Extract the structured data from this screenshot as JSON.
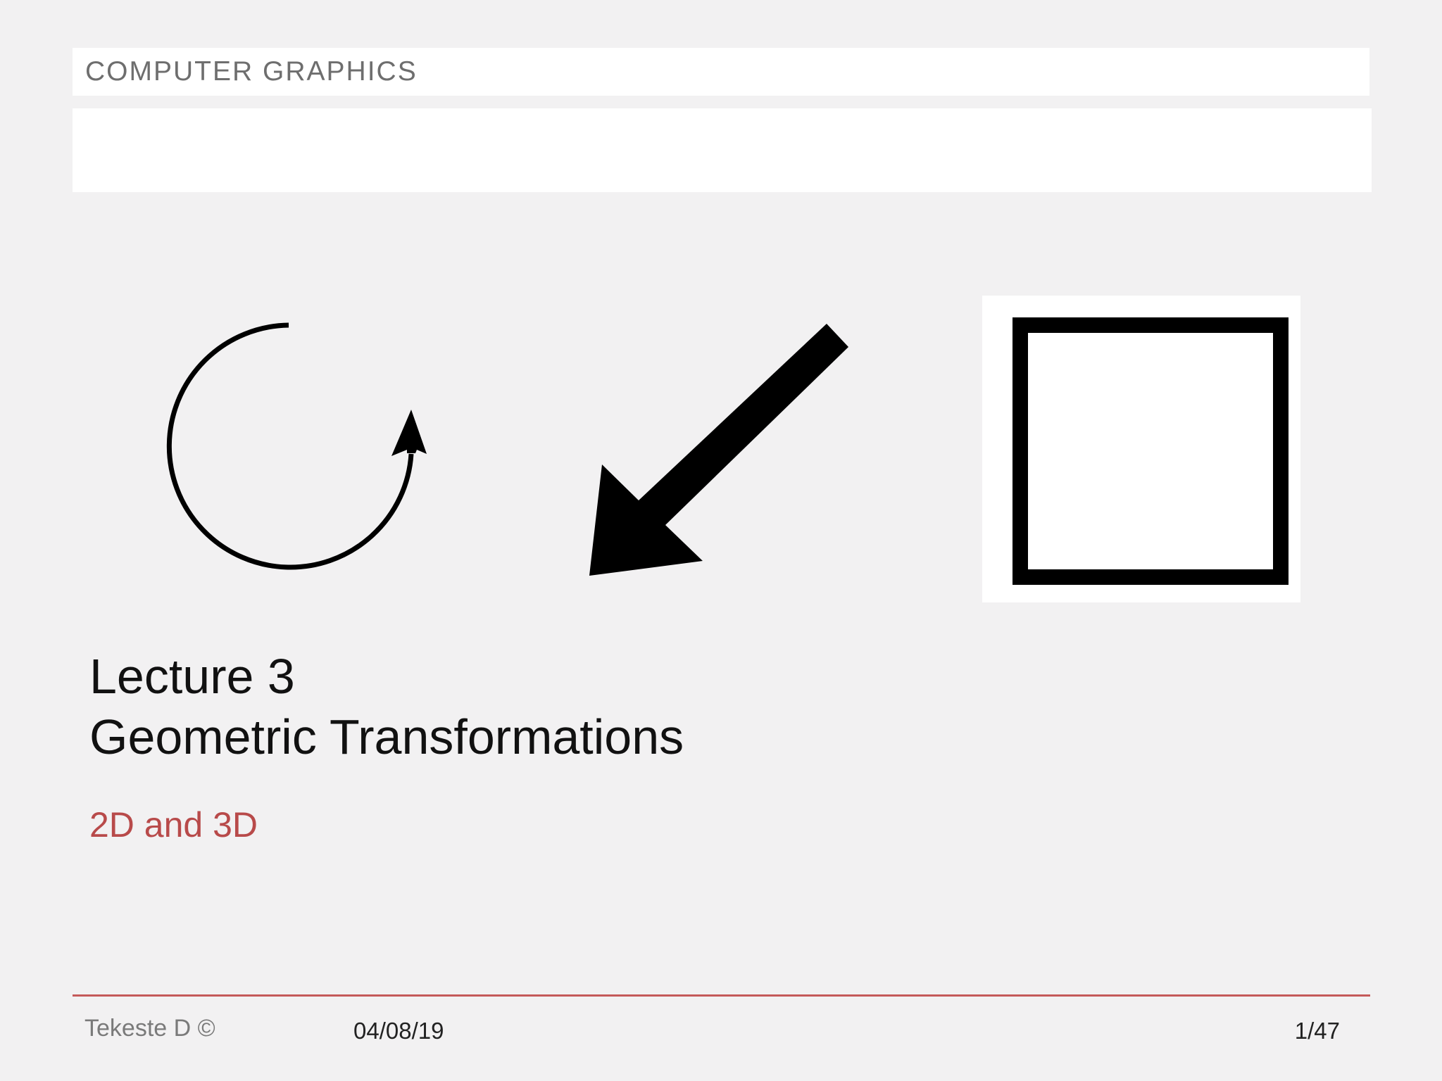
{
  "header": {
    "label": "COMPUTER GRAPHICS"
  },
  "icons": {
    "rotation": "rotate-icon",
    "translation": "arrow-down-left-icon",
    "scaling": "square-icon"
  },
  "slide": {
    "title_line1": "Lecture 3",
    "title_line2": "Geometric Transformations",
    "subtitle": "2D and 3D"
  },
  "footer": {
    "author": "Tekeste D ©",
    "date": "04/08/19",
    "page": "1/47"
  },
  "colors": {
    "background": "#f2f1f2",
    "accent": "#b84a4a",
    "rule": "#c55a5a"
  }
}
